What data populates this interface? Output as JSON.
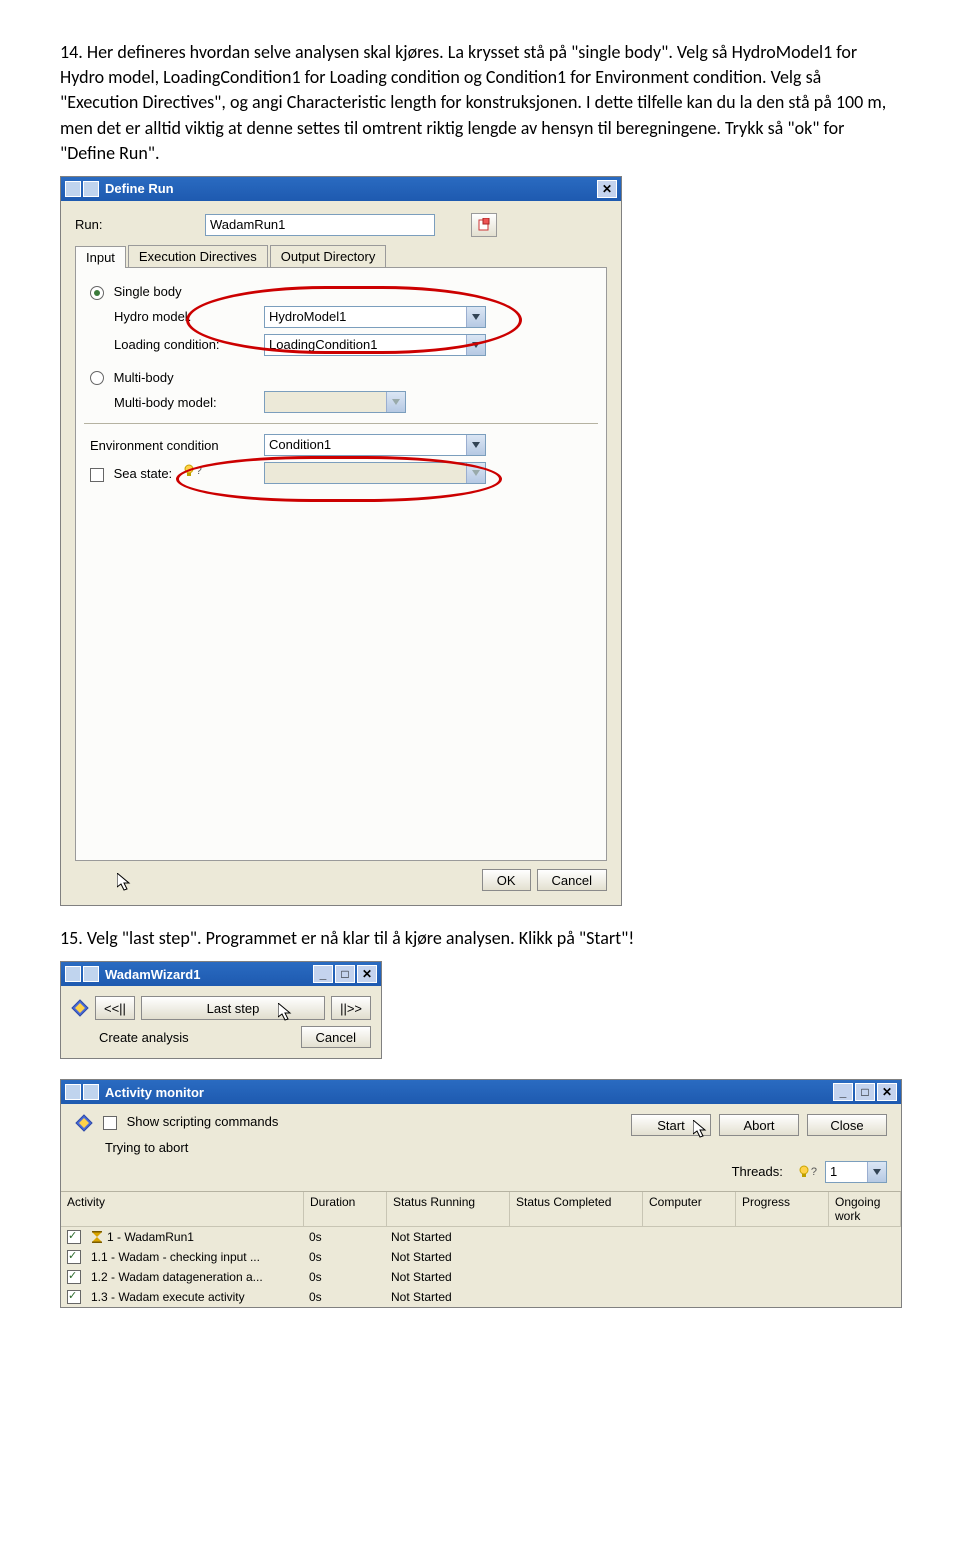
{
  "instructions": {
    "step14": "14. Her defineres hvordan selve analysen skal kjøres. La krysset stå på \"single body\". Velg så HydroModel1 for Hydro model, LoadingCondition1 for Loading condition og Condition1 for Environment condition. Velg så \"Execution Directives\", og angi Characteristic length for konstruksjonen. I dette tilfelle kan du la den stå på 100 m, men det er alltid viktig at denne settes til omtrent riktig lengde av hensyn til beregningene. Trykk så \"ok\" for \"Define Run\".",
    "step15": "15. Velg \"last step\". Programmet er nå klar til å kjøre analysen. Klikk på \"Start\"!"
  },
  "defineRun": {
    "title": "Define Run",
    "runLabel": "Run:",
    "runValue": "WadamRun1",
    "tabs": {
      "input": "Input",
      "exec": "Execution Directives",
      "outdir": "Output Directory"
    },
    "singleBody": "Single body",
    "hydroModel": "Hydro model:",
    "hydroModelVal": "HydroModel1",
    "loadingCond": "Loading condition:",
    "loadingCondVal": "LoadingCondition1",
    "multiBody": "Multi-body",
    "multiBodyModel": "Multi-body model:",
    "envCond": "Environment condition",
    "envCondVal": "Condition1",
    "seaState": "Sea state:",
    "ok": "OK",
    "cancel": "Cancel"
  },
  "wizard": {
    "title": "WadamWizard1",
    "back": "<<||",
    "step": "Last step",
    "fwd": "||>>",
    "create": "Create analysis",
    "cancel": "Cancel"
  },
  "activity": {
    "title": "Activity monitor",
    "showScripting": "Show scripting commands",
    "tryingAbort": "Trying to abort",
    "start": "Start",
    "abort": "Abort",
    "close": "Close",
    "threads": "Threads:",
    "threadsVal": "1",
    "cols": {
      "activity": "Activity",
      "duration": "Duration",
      "srun": "Status Running",
      "scomp": "Status Completed",
      "computer": "Computer",
      "progress": "Progress",
      "ongoing": "Ongoing work"
    },
    "rows": [
      {
        "name": "1 - WadamRun1",
        "dur": "0s",
        "status": "Not Started",
        "hour": true
      },
      {
        "name": "1.1 - Wadam - checking input ...",
        "dur": "0s",
        "status": "Not Started",
        "hour": false
      },
      {
        "name": "1.2 - Wadam datageneration a...",
        "dur": "0s",
        "status": "Not Started",
        "hour": false
      },
      {
        "name": "1.3 - Wadam execute activity",
        "dur": "0s",
        "status": "Not Started",
        "hour": false
      }
    ]
  }
}
